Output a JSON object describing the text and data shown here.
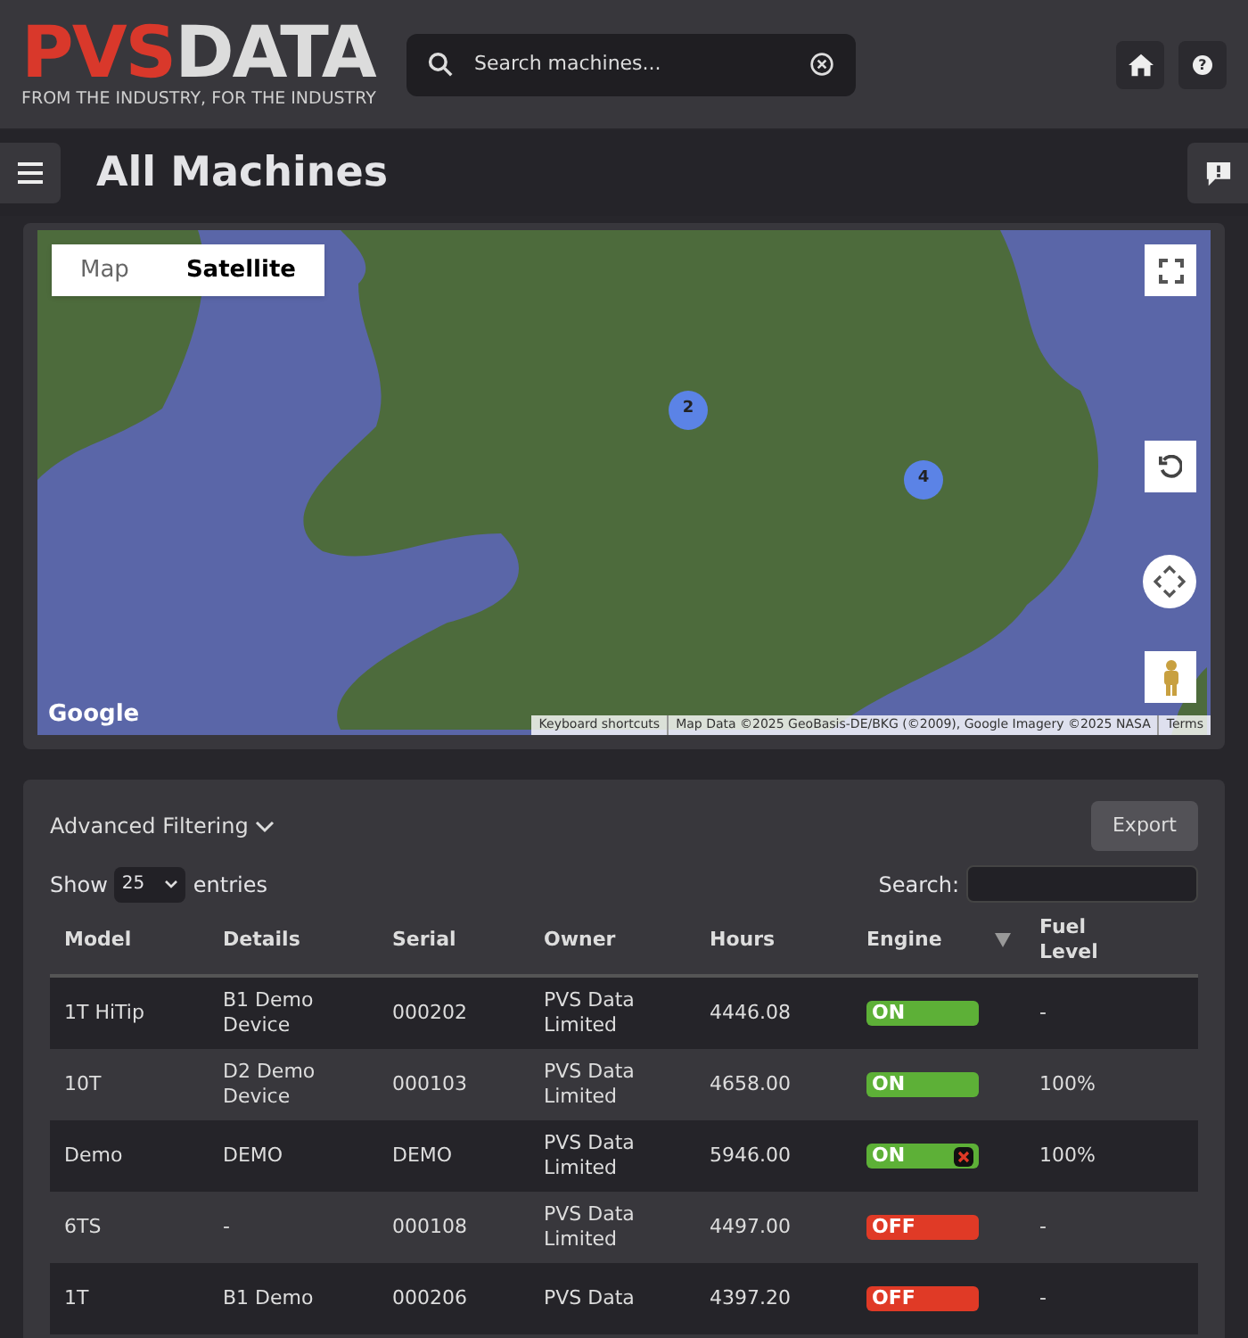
{
  "header": {
    "logo_brand": "PVS",
    "logo_brand_2": "DATA",
    "tagline": "FROM THE INDUSTRY, FOR THE INDUSTRY",
    "search": {
      "placeholder": "Search machines..."
    },
    "help_button": "?"
  },
  "page_title": "All Machines",
  "map": {
    "map_types": [
      {
        "label": "Map",
        "selected": false
      },
      {
        "label": "Satellite",
        "selected": true
      }
    ],
    "clusters": [
      "2",
      "4"
    ],
    "google_logo": "Google",
    "attribution": [
      "Keyboard shortcuts",
      "Map Data ©2025 GeoBasis-DE/BKG (©2009), Google Imagery ©2025 NASA",
      "Terms"
    ]
  },
  "filtering": {
    "advanced_label": "Advanced Filtering",
    "export": "Export",
    "show_label": "Show",
    "page_size": "25",
    "entries_label": "entries",
    "search_label": "Search:"
  },
  "table": {
    "columns": [
      "Model",
      "Details",
      "Serial",
      "Owner",
      "Hours",
      "Engine",
      "Fuel Level"
    ],
    "rows": [
      {
        "model": "1T HiTip",
        "details": "B1 Demo Device",
        "serial": "000202",
        "owner": "PVS Data Limited",
        "hours": "4446.08",
        "engine": {
          "label": "ON",
          "on": true,
          "alert": false
        },
        "fuel": "-"
      },
      {
        "model": "10T",
        "details": "D2 Demo Device",
        "serial": "000103",
        "owner": "PVS Data Limited",
        "hours": "4658.00",
        "engine": {
          "label": "ON",
          "on": true,
          "alert": false
        },
        "fuel": "100%"
      },
      {
        "model": "Demo",
        "details": "DEMO",
        "serial": "DEMO",
        "owner": "PVS Data Limited",
        "hours": "5946.00",
        "engine": {
          "label": "ON",
          "on": true,
          "alert": true
        },
        "fuel": "100%"
      },
      {
        "model": "6TS",
        "details": "-",
        "serial": "000108",
        "owner": "PVS Data Limited",
        "hours": "4497.00",
        "engine": {
          "label": "OFF",
          "on": false,
          "alert": false
        },
        "fuel": "-"
      },
      {
        "model": "1T",
        "details": "B1 Demo",
        "serial": "000206",
        "owner": "PVS Data",
        "hours": "4397.20",
        "engine": {
          "label": "OFF",
          "on": false,
          "alert": false
        },
        "fuel": "-"
      }
    ]
  }
}
